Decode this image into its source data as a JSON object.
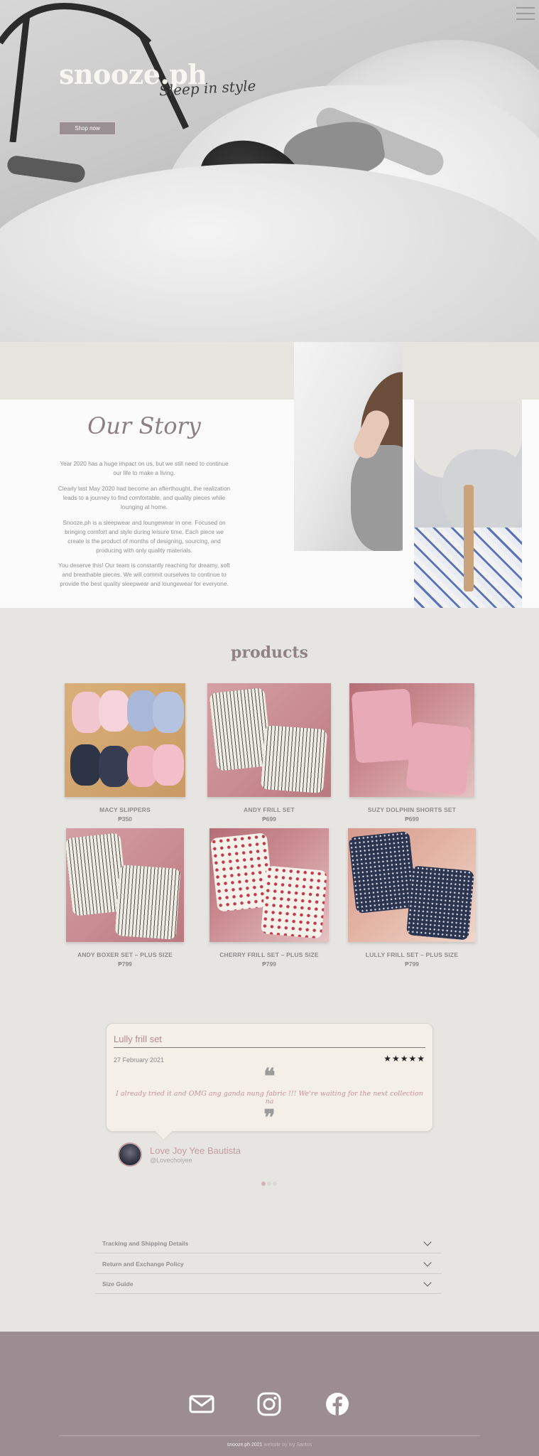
{
  "hero": {
    "brand": "snooze.ph",
    "tagline": "Sleep in style",
    "shop_button": "Shop now",
    "menu_icon": "hamburger-menu-icon"
  },
  "story": {
    "title": "Our Story",
    "paragraphs": [
      "Year 2020 has a huge impact on us, but we still need to continue our life to make a living.",
      "Clearly last May 2020 had become an afterthought, the realization leads to a journey to find comfortable, and quality pieces while lounging at home.",
      "Snooze.ph is a sleepwear and loungewear in one. Focused on bringing comfort and style during leisure time. Each piece we create is the product of months of designing, sourcing, and producing with only quality materials.",
      "You deserve this! Our team is constantly reaching for dreamy, soft and breathable pieces. We will commit ourselves to continue to provide the best quality sleepwear and loungewear for everyone."
    ]
  },
  "products": {
    "title": "products",
    "items": [
      {
        "name": "MACY SLIPPERS",
        "price": "₱350"
      },
      {
        "name": "ANDY FRILL SET",
        "price": "₱699"
      },
      {
        "name": "SUZY DOLPHIN SHORTS SET",
        "price": "₱699"
      },
      {
        "name": "ANDY BOXER SET – PLUS SIZE",
        "price": "₱799"
      },
      {
        "name": "CHERRY FRILL SET – PLUS SIZE",
        "price": "₱799"
      },
      {
        "name": "LULLY FRILL SET – PLUS SIZE",
        "price": "₱799"
      }
    ]
  },
  "review": {
    "title": "Lully frill set",
    "date": "27 February 2021",
    "stars": "★★★★★",
    "open_quote": "❝",
    "close_quote": "❞",
    "text": "I already tried it and OMG ang ganda nung fabric !!! We're waiting for the next collection na",
    "reviewer_name": "Love Joy Yee Bautista",
    "reviewer_handle": "@Lovechoiyee",
    "slide_count": 3,
    "active_slide": 1
  },
  "accordion": [
    {
      "label": "Tracking and Shipping Details"
    },
    {
      "label": "Return and Exchange Policy"
    },
    {
      "label": "Size Guide"
    }
  ],
  "footer": {
    "icons": [
      "email-icon",
      "instagram-icon",
      "facebook-icon"
    ],
    "copyright": "snooze.ph 2021",
    "credit": "website by Ivy Santos"
  },
  "colors": {
    "page_bg": "#e7e5e2",
    "accent_mauve": "#9b8d91",
    "accent_pink": "#c49ba0"
  }
}
